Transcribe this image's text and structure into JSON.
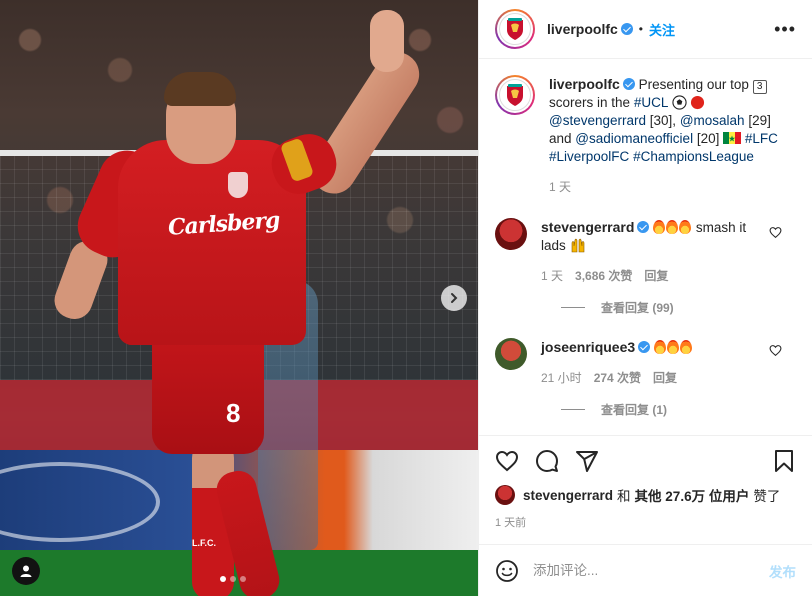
{
  "header": {
    "username": "liverpoolfc",
    "follow_label": "关注",
    "more_label": "•••"
  },
  "caption": {
    "username": "liverpoolfc",
    "text_1": "Presenting our top",
    "badge": "3",
    "text_2": "scorers in the",
    "hashtag_ucl": "#UCL",
    "mention_1": "@stevengerrard",
    "count_1": "[30],",
    "mention_2": "@mosalah",
    "count_2": "[29] and",
    "mention_3": "@sadiomaneofficiel",
    "count_3": "[20]",
    "hashtag_lfc": "#LFC",
    "hashtag_liverpoolfc": "#LiverpoolFC",
    "hashtag_champions": "#ChampionsLeague",
    "time": "1 天"
  },
  "comments": [
    {
      "username": "stevengerrard",
      "text": "smash it lads",
      "time": "1 天",
      "likes": "3,686 次赞",
      "reply_label": "回复",
      "view_replies": "查看回复 (99)"
    },
    {
      "username": "joseenriquee3",
      "text": "",
      "time": "21 小时",
      "likes": "274 次赞",
      "reply_label": "回复",
      "view_replies": "查看回复 (1)"
    }
  ],
  "likes": {
    "user": "stevengerrard",
    "conj": "和",
    "others": "其他 27.6万 位用户",
    "suffix": "赞了"
  },
  "post_time": "1 天前",
  "comment_box": {
    "placeholder": "添加评论...",
    "post_label": "发布"
  },
  "media": {
    "sponsor_text": "Carlsberg",
    "shirt_number": "8",
    "sock_text": "L.F.C."
  },
  "carousel": {
    "slides": 3,
    "active": 1
  },
  "colors": {
    "accent": "#0095f6",
    "verified": "#3897f0",
    "post_disabled": "#b2dffc",
    "muted": "#8e8e8e"
  }
}
